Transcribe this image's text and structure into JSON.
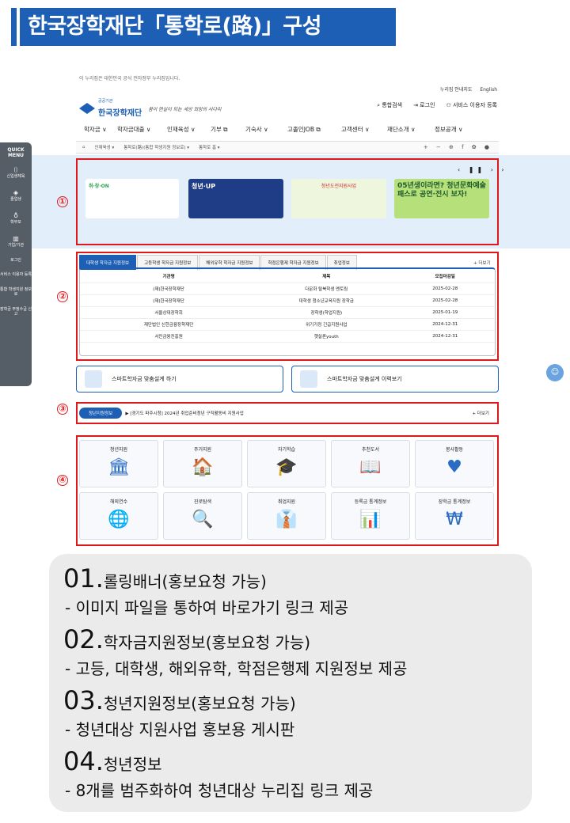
{
  "page_title": "한국장학재단「통학로(路)」구성",
  "site": {
    "gov_notice": "이 누리집은 대한민국 공식 전자정부 누리집입니다.",
    "util_links": [
      "누리집 안내지도",
      "English"
    ],
    "logo_sub": "공공기관",
    "logo_main": "한국장학재단",
    "slogan": "꿈이 현실이 되는 세상 희망의 사다리",
    "head_links": [
      "통합검색",
      "로그인",
      "서비스 이용자 등록"
    ],
    "nav": [
      "학자금 ∨",
      "학자금대출 ∨",
      "인재육성 ∨",
      "기부 ⧉",
      "기숙사 ∨",
      "고졸인JOB ⧉",
      "고객센터 ∨",
      "재단소개 ∨",
      "정보공개 ∨"
    ],
    "breadcrumb": [
      "⌂",
      "인재육성 ▾",
      "통학로(路)(통합 학생지원 정보로) ▾",
      "통학로 홈 ▾"
    ],
    "breadcrumb_tools": "+ − ⊕ f ✿ ●"
  },
  "quick_menu": {
    "head": "QUICK MENU",
    "items": [
      {
        "icon": "⌷",
        "label": "신입생체육"
      },
      {
        "icon": "◈",
        "label": "졸업생"
      },
      {
        "icon": "♁",
        "label": "학부모"
      },
      {
        "icon": "▥",
        "label": "기업/기관"
      },
      {
        "icon": "",
        "label": "로그인"
      },
      {
        "icon": "",
        "label": "서비스 이용자 등록"
      },
      {
        "icon": "",
        "label": "통합 학생지원 정보로"
      },
      {
        "icon": "",
        "label": "장학금 부정수급 신고"
      }
    ]
  },
  "banners": {
    "controls": "‹ ❚❚ › ›",
    "items": [
      {
        "text": "취·창·ON"
      },
      {
        "text": "청년·UP"
      },
      {
        "text": "청년도전지원사업"
      },
      {
        "text": "05년생이라면? 청년문화예술패스로 공연·전시 보자!"
      }
    ]
  },
  "scholarship": {
    "tabs": [
      "대학생 학자금 지원정보",
      "고등학생 학자금 지원정보",
      "해외유학 학자금 지원정보",
      "학점은행제 학자금 지원정보",
      "취업정보"
    ],
    "more": "+ 더보기",
    "headers": [
      "기관명",
      "제목",
      "모집마감일"
    ],
    "rows": [
      [
        "(재)한국장학재단",
        "다문화 탈북학생 멘토링",
        "2025-02-28"
      ],
      [
        "(재)한국장학재단",
        "대학생 청소년교육지원 장학금",
        "2025-02-28"
      ],
      [
        "서울상대장학회",
        "장학생(학업지원)",
        "2025-01-19"
      ],
      [
        "재단법인 신한금융장학재단",
        "위기가정 긴급지원사업",
        "2024-12-31"
      ],
      [
        "서민금융진흥원",
        "햇살론youth",
        "2024-12-31"
      ]
    ]
  },
  "smart_buttons": [
    "스마트학자금 맞춤설계 하기",
    "스마트학자금 맞춤설계 이력보기"
  ],
  "youth_board": {
    "pill": "청년지원정보",
    "text": "▶ [경기도 파주시청] 2024년 취업준비청년 구직활동비 지원사업",
    "more": "+ 더보기"
  },
  "youth_cards": [
    {
      "label": "청년지원",
      "icon": "🏛"
    },
    {
      "label": "주거지원",
      "icon": "🏠"
    },
    {
      "label": "자기학습",
      "icon": "🎓"
    },
    {
      "label": "추천도서",
      "icon": "📖"
    },
    {
      "label": "봉사활동",
      "icon": "♥"
    },
    {
      "label": "해외연수",
      "icon": "🌐"
    },
    {
      "label": "진로탐색",
      "icon": "🔍"
    },
    {
      "label": "취업지원",
      "icon": "👔"
    },
    {
      "label": "등록금 통계정보",
      "icon": "📊"
    },
    {
      "label": "장학금 통계정보",
      "icon": "₩"
    }
  ],
  "callouts": [
    "①",
    "②",
    "③",
    "④"
  ],
  "descriptions": [
    {
      "num": "01.",
      "title": "롤링배너(홍보요청 가능)",
      "sub": "- 이미지 파일을 통하여 바로가기 링크 제공"
    },
    {
      "num": "02.",
      "title": "학자금지원정보(홍보요청 가능)",
      "sub": "- 고등, 대학생, 해외유학, 학점은행제 지원정보 제공"
    },
    {
      "num": "03.",
      "title": "청년지원정보(홍보요청 가능)",
      "sub": "- 청년대상 지원사업 홍보용 게시판"
    },
    {
      "num": "04.",
      "title": "청년정보",
      "sub": "- 8개를 범주화하여 청년대상 누리집 링크 제공"
    }
  ]
}
